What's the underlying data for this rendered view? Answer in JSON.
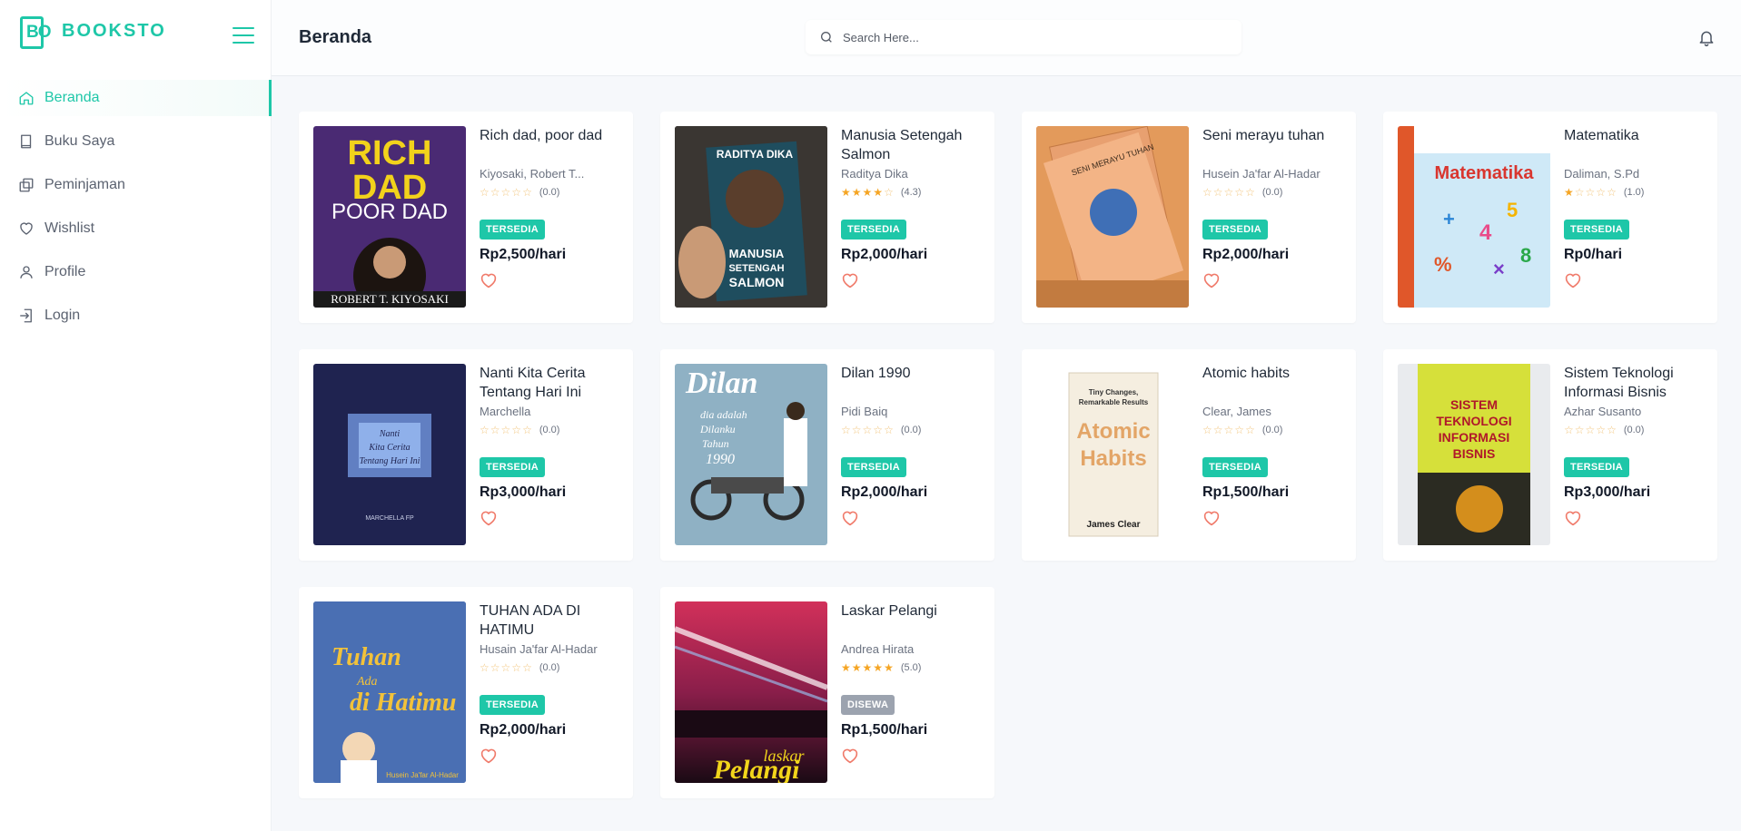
{
  "app": {
    "brand_logo_text": "BO",
    "brand_name": "BOOKSTO"
  },
  "sidebar": {
    "items": [
      {
        "label": "Beranda",
        "icon": "home-icon",
        "active": true
      },
      {
        "label": "Buku Saya",
        "icon": "book-icon",
        "active": false
      },
      {
        "label": "Peminjaman",
        "icon": "copy-icon",
        "active": false
      },
      {
        "label": "Wishlist",
        "icon": "heart-icon",
        "active": false
      },
      {
        "label": "Profile",
        "icon": "user-icon",
        "active": false
      },
      {
        "label": "Login",
        "icon": "login-icon",
        "active": false
      }
    ]
  },
  "header": {
    "title": "Beranda",
    "search_placeholder": "Search Here...",
    "search_value": ""
  },
  "colors": {
    "accent": "#1ec7a8",
    "rented": "#9ca3af",
    "heart": "#f07a6a",
    "star": "#f5a524"
  },
  "books": [
    {
      "title": "Rich dad, poor dad",
      "author": "Kiyosaki, Robert T...",
      "rating": 0.0,
      "rating_text": "(0.0)",
      "status": "TERSEDIA",
      "available": true,
      "price": "Rp2,500/hari"
    },
    {
      "title": "Manusia Setengah Salmon",
      "author": "Raditya Dika",
      "rating": 4.3,
      "rating_text": "(4.3)",
      "status": "TERSEDIA",
      "available": true,
      "price": "Rp2,000/hari"
    },
    {
      "title": "Seni merayu tuhan",
      "author": "Husein Ja'far Al-Hadar",
      "rating": 0.0,
      "rating_text": "(0.0)",
      "status": "TERSEDIA",
      "available": true,
      "price": "Rp2,000/hari"
    },
    {
      "title": "Matematika",
      "author": "Daliman, S.Pd",
      "rating": 1.0,
      "rating_text": "(1.0)",
      "status": "TERSEDIA",
      "available": true,
      "price": "Rp0/hari"
    },
    {
      "title": "Nanti Kita Cerita Tentang Hari Ini",
      "author": "Marchella",
      "rating": 0.0,
      "rating_text": "(0.0)",
      "status": "TERSEDIA",
      "available": true,
      "price": "Rp3,000/hari"
    },
    {
      "title": "Dilan 1990",
      "author": "Pidi Baiq",
      "rating": 0.0,
      "rating_text": "(0.0)",
      "status": "TERSEDIA",
      "available": true,
      "price": "Rp2,000/hari"
    },
    {
      "title": "Atomic habits",
      "author": "Clear, James",
      "rating": 0.0,
      "rating_text": "(0.0)",
      "status": "TERSEDIA",
      "available": true,
      "price": "Rp1,500/hari"
    },
    {
      "title": "Sistem Teknologi Informasi Bisnis",
      "author": "Azhar Susanto",
      "rating": 0.0,
      "rating_text": "(0.0)",
      "status": "TERSEDIA",
      "available": true,
      "price": "Rp3,000/hari"
    },
    {
      "title": "TUHAN ADA DI HATIMU",
      "author": "Husain Ja'far Al-Hadar",
      "rating": 0.0,
      "rating_text": "(0.0)",
      "status": "TERSEDIA",
      "available": true,
      "price": "Rp2,000/hari"
    },
    {
      "title": "Laskar Pelangi",
      "author": "Andrea Hirata",
      "rating": 5.0,
      "rating_text": "(5.0)",
      "status": "DISEWA",
      "available": false,
      "price": "Rp1,500/hari"
    }
  ]
}
